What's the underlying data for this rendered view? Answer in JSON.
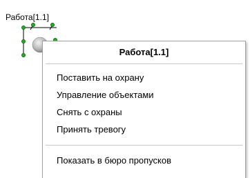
{
  "object": {
    "label": "Работа[1.1]",
    "icon": "security-zone-icon"
  },
  "context_menu": {
    "header": "Работа[1.1]",
    "items": [
      {
        "label": "Поставить на охрану"
      },
      {
        "label": "Управление объектами"
      },
      {
        "label": "Снять с охраны"
      },
      {
        "label": "Принять тревогу"
      },
      {
        "label": "Показать в бюро пропусков"
      }
    ]
  }
}
